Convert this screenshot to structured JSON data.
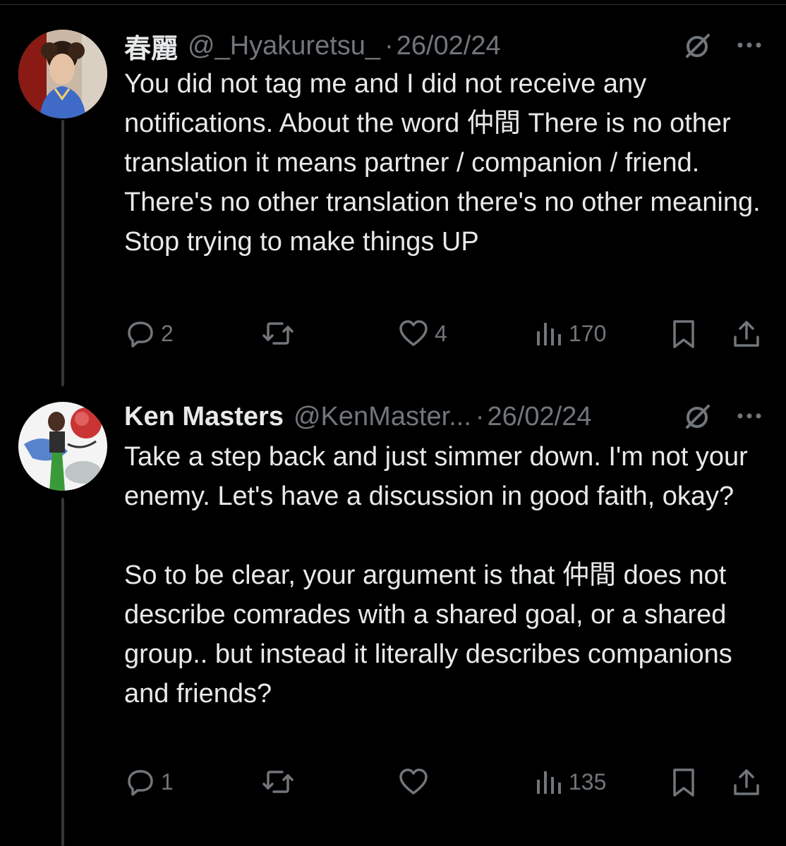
{
  "tweets": [
    {
      "name": "春麗",
      "handle": "@_Hyakuretsu_",
      "dot": "·",
      "date": "26/02/24",
      "text": "You did not tag me and I did not receive any notifications. About the word 仲間 There is no other translation it means partner / companion / friend. There's no other translation there's no other meaning. Stop trying to make things UP",
      "replies": "2",
      "reposts": "",
      "likes": "4",
      "views": "170"
    },
    {
      "name": "Ken Masters",
      "handle": "@KenMaster...",
      "dot": "·",
      "date": "26/02/24",
      "text": "Take a step back and just simmer down. I'm not your enemy. Let's have a discussion in good faith, okay?\n\nSo to be clear, your argument is that 仲間 does not describe comrades with a shared goal, or a shared group.. but instead it literally describes companions and friends?",
      "replies": "1",
      "reposts": "",
      "likes": "",
      "views": "135"
    }
  ],
  "icons": {
    "reply": "reply-icon",
    "repost": "repost-icon",
    "like": "heart-icon",
    "views": "views-icon",
    "bookmark": "bookmark-icon",
    "share": "share-icon",
    "grok": "grok-icon",
    "more": "more-icon"
  },
  "colors": {
    "background": "#000000",
    "text": "#e7e9ea",
    "secondary": "#71767b",
    "thread_line": "#333639"
  }
}
